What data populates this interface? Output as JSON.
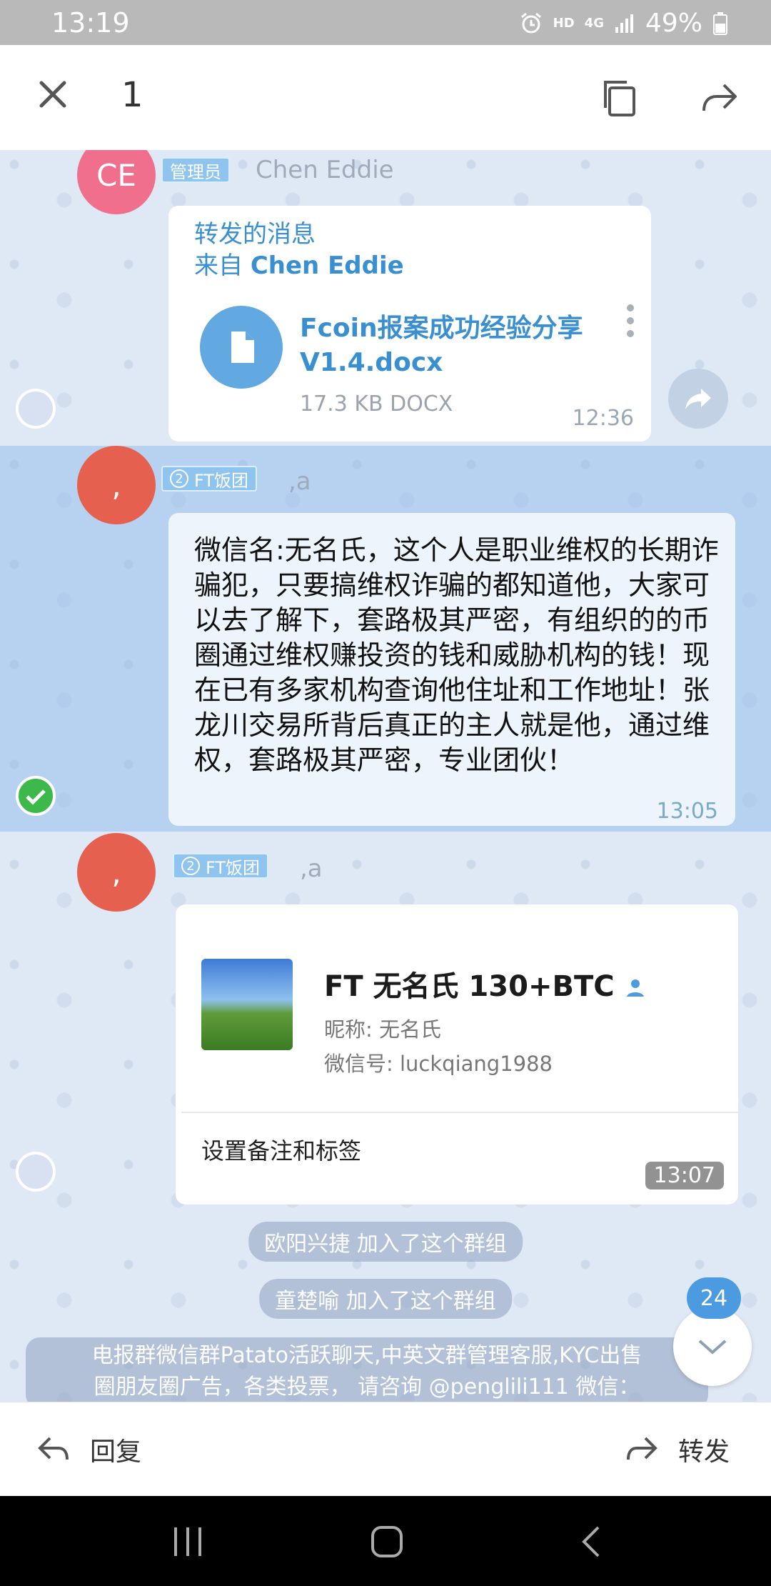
{
  "status": {
    "time": "13:19",
    "hd": "HD",
    "net": "4G",
    "battery": "49%"
  },
  "topbar": {
    "selected_count": "1"
  },
  "messages": [
    {
      "avatar_text": "CE",
      "badge": "管理员",
      "sender": "Chen Eddie",
      "forward_prefix": "转发的消息",
      "forward_from_label": "来自",
      "forward_from_name": "Chen Eddie",
      "file_name_line1": "Fcoin报案成功经验分享",
      "file_name_line2": "V1.4.docx",
      "file_size": "17.3 KB DOCX",
      "time": "12:36"
    },
    {
      "avatar_text": ",",
      "badge_num": "2",
      "badge": "FT饭团",
      "sender": ",a",
      "text": "微信名:无名氏，这个人是职业维权的长期诈骗犯，只要搞维权诈骗的都知道他，大家可以去了解下，套路极其严密，有组织的的币圈通过维权赚投资的钱和威胁机构的钱！现在已有多家机构查询他住址和工作地址！张龙川交易所背后真正的主人就是他，通过维权，套路极其严密，专业团伙！",
      "time": "13:05"
    },
    {
      "avatar_text": ",",
      "badge_num": "2",
      "badge": "FT饭团",
      "sender": ",a",
      "card_title": "FT 无名氏 130+BTC",
      "card_nickname": "昵称:  无名氏",
      "card_wechat": "微信号:  luckqiang1988",
      "card_note": "设置备注和标签",
      "time": "13:07"
    }
  ],
  "service": [
    "欧阳兴捷 加入了这个群组",
    "童楚喻 加入了这个群组"
  ],
  "ad_line1": "电报群微信群Patato活跃聊天,中英文群管理客服,KYC出售",
  "ad_line2": "圈朋友圈广告，各类投票， 请咨询 @penglili111 微信：",
  "unread_count": "24",
  "bottom": {
    "reply": "回复",
    "forward": "转发"
  },
  "colors": {
    "accent": "#3a8fd0",
    "avatar_ce": "#ef6f8d",
    "avatar_comma": "#e5604e",
    "check": "#3db84b"
  }
}
